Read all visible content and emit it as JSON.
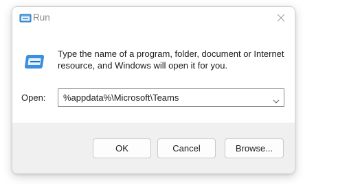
{
  "window": {
    "title": "Run",
    "title_icon": "run-icon",
    "close_icon": "close-icon"
  },
  "message": "Type the name of a program, folder, document or Internet resource, and Windows will open it for you.",
  "open": {
    "label": "Open:",
    "value": "%appdata%\\Microsoft\\Teams",
    "dropdown_icon": "chevron-down-icon"
  },
  "buttons": {
    "ok": "OK",
    "cancel": "Cancel",
    "browse": "Browse..."
  },
  "colors": {
    "accent": "#0067c0",
    "footer": "#f0f0f0"
  }
}
